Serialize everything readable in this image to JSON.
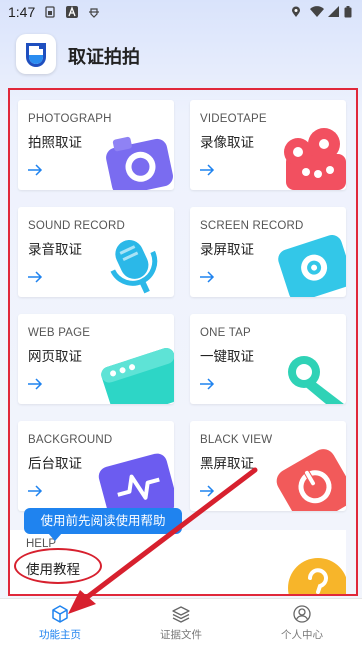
{
  "status": {
    "time": "1:47"
  },
  "header": {
    "title": "取证拍拍"
  },
  "cards": [
    {
      "en": "PHOTOGRAPH",
      "zh": "拍照取证",
      "icon": "camera-icon",
      "color": "#7a6cf0"
    },
    {
      "en": "VIDEOTAPE",
      "zh": "录像取证",
      "icon": "video-reel-icon",
      "color": "#f25060"
    },
    {
      "en": "SOUND RECORD",
      "zh": "录音取证",
      "icon": "microphone-icon",
      "color": "#2bb8e8"
    },
    {
      "en": "SCREEN RECORD",
      "zh": "录屏取证",
      "icon": "screen-record-icon",
      "color": "#33c7e8"
    },
    {
      "en": "WEB PAGE",
      "zh": "网页取证",
      "icon": "browser-icon",
      "color": "#2dd6c6"
    },
    {
      "en": "ONE TAP",
      "zh": "一键取证",
      "icon": "touch-icon",
      "color": "#2fd2b6"
    },
    {
      "en": "BACKGROUND",
      "zh": "后台取证",
      "icon": "background-pulse-icon",
      "color": "#6c5cf0"
    },
    {
      "en": "BLACK VIEW",
      "zh": "黑屏取证",
      "icon": "power-icon",
      "color": "#f25a5a"
    }
  ],
  "help": {
    "en": "HELP",
    "zh": "使用教程",
    "tooltip": "使用前先阅读使用帮助",
    "icon": "question-icon"
  },
  "bottom_nav": [
    {
      "label": "功能主页",
      "icon": "cube-icon",
      "active": true
    },
    {
      "label": "证据文件",
      "icon": "layers-icon",
      "active": false
    },
    {
      "label": "个人中心",
      "icon": "user-icon",
      "active": false
    }
  ],
  "colors": {
    "accent": "#1f83ef",
    "annotation": "#d7202e"
  }
}
